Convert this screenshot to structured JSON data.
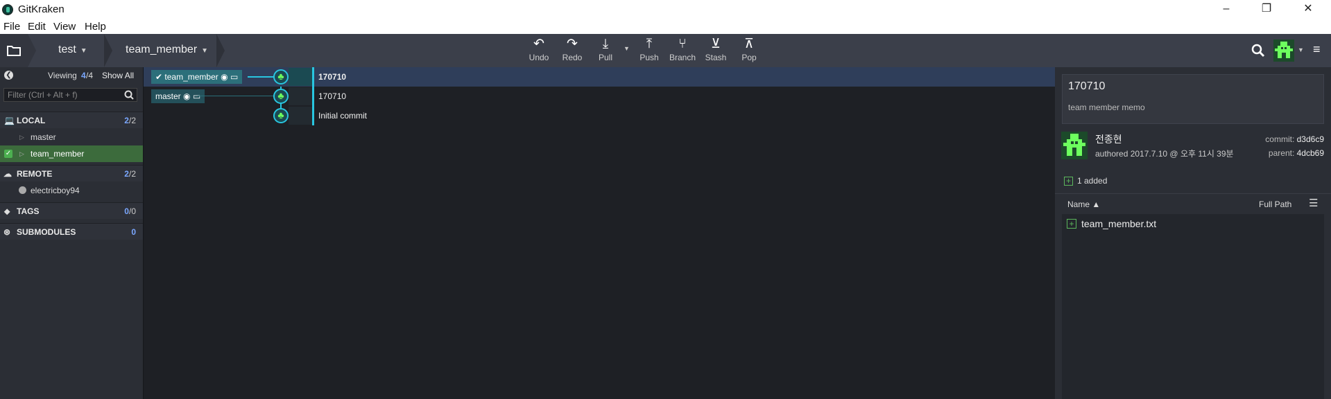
{
  "app": {
    "title": "GitKraken"
  },
  "menu": [
    "File",
    "Edit",
    "View",
    "Help"
  ],
  "toolbar": {
    "repo": "test",
    "branch": "team_member",
    "actions": [
      {
        "label": "Undo",
        "icon": "undo-icon"
      },
      {
        "label": "Redo",
        "icon": "redo-icon"
      },
      {
        "label": "Pull",
        "icon": "pull-icon"
      },
      {
        "label": "Push",
        "icon": "push-icon"
      },
      {
        "label": "Branch",
        "icon": "branch-icon"
      },
      {
        "label": "Stash",
        "icon": "stash-icon"
      },
      {
        "label": "Pop",
        "icon": "pop-icon"
      }
    ]
  },
  "sidebar": {
    "viewing_label": "Viewing",
    "viewing_count": "4",
    "viewing_total": "/4",
    "show_all": "Show All",
    "filter_placeholder": "Filter (Ctrl + Alt + f)",
    "local": {
      "label": "LOCAL",
      "count": "2",
      "total": "/2",
      "items": [
        "master",
        "team_member"
      ]
    },
    "remote": {
      "label": "REMOTE",
      "count": "2",
      "total": "/2",
      "items": [
        "electricboy94"
      ]
    },
    "tags": {
      "label": "TAGS",
      "count": "0",
      "total": "/0"
    },
    "submodules": {
      "label": "SUBMODULES",
      "count": "0"
    }
  },
  "graph": {
    "commits": [
      {
        "branch": "team_member",
        "message": "170710"
      },
      {
        "branch": "master",
        "message": "170710"
      },
      {
        "branch": "",
        "message": "Initial commit"
      }
    ]
  },
  "details": {
    "message": "170710",
    "description": "team member memo",
    "author": "전종현",
    "authored": "authored 2017.7.10 @ 오후 11시 39분",
    "commit_label": "commit:",
    "commit_sha": "d3d6c9",
    "parent_label": "parent:",
    "parent_sha": "4dcb69",
    "added": "1 added",
    "col_name": "Name",
    "col_path": "Full Path",
    "files": [
      "team_member.txt"
    ]
  },
  "colors": {
    "accent": "#29c6e0",
    "node_green": "#6dff5e",
    "selected_row": "#2f3e5a"
  }
}
